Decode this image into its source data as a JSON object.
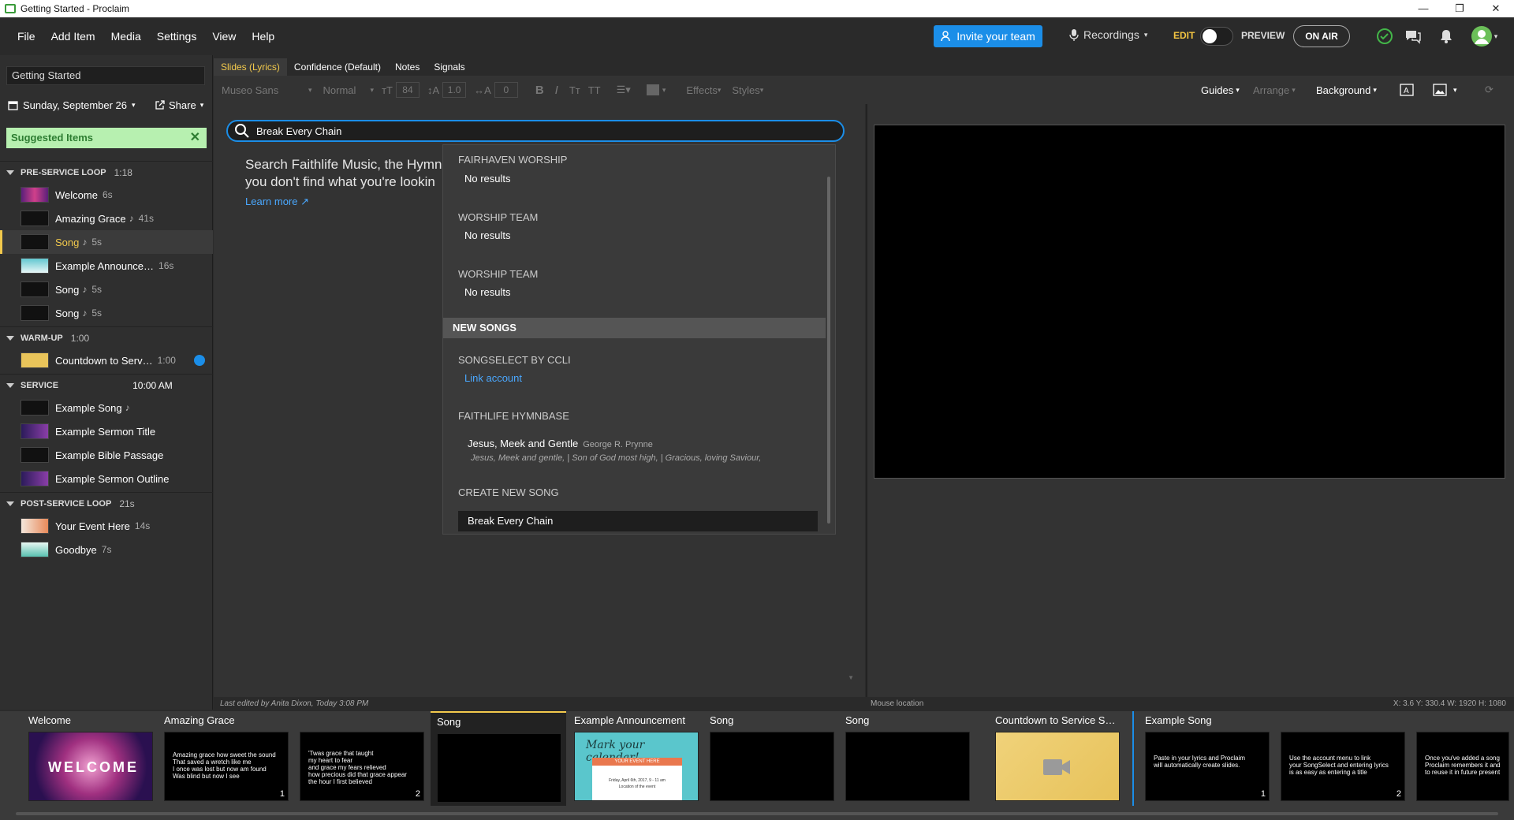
{
  "window": {
    "title": "Getting Started - Proclaim",
    "min": "—",
    "max": "❐",
    "close": "✕"
  },
  "menu": [
    "File",
    "Add Item",
    "Media",
    "Settings",
    "View",
    "Help"
  ],
  "topbar": {
    "invite_label": "Invite your team",
    "recordings_label": "Recordings",
    "edit_label": "EDIT",
    "preview_label": "PREVIEW",
    "onair_label": "ON AIR",
    "accent": "#1b8ee8"
  },
  "left": {
    "doc_name": "Getting Started",
    "date": "Sunday, September 26",
    "share": "Share",
    "suggested": "Suggested Items",
    "sections": [
      {
        "name": "PRE-SERVICE LOOP",
        "dur": "1:18"
      },
      {
        "name": "WARM-UP",
        "dur": "1:00"
      },
      {
        "name": "SERVICE",
        "dur": "10:00 AM"
      },
      {
        "name": "POST-SERVICE LOOP",
        "dur": "21s"
      }
    ],
    "items": [
      {
        "label": "Welcome",
        "dur": "6s"
      },
      {
        "label": "Amazing Grace",
        "note": "♪",
        "dur": "41s"
      },
      {
        "label": "Song",
        "note": "♪",
        "dur": "5s"
      },
      {
        "label": "Example Announce…",
        "dur": "16s"
      },
      {
        "label": "Song",
        "note": "♪",
        "dur": "5s"
      },
      {
        "label": "Song",
        "note": "♪",
        "dur": "5s"
      },
      {
        "label": "Countdown to Serv…",
        "dur": "1:00"
      },
      {
        "label": "Example Song",
        "note": "♪"
      },
      {
        "label": "Example Sermon Title"
      },
      {
        "label": "Example Bible Passage"
      },
      {
        "label": "Example Sermon Outline"
      },
      {
        "label": "Your Event Here",
        "dur": "14s"
      },
      {
        "label": "Goodbye",
        "dur": "7s"
      }
    ]
  },
  "tabs": [
    "Slides (Lyrics)",
    "Confidence (Default)",
    "Notes",
    "Signals"
  ],
  "toolbar": {
    "font": "Museo Sans",
    "style": "Normal",
    "size": "84",
    "line": "1.0",
    "spacing": "0",
    "effects": "Effects",
    "styles": "Styles",
    "guides": "Guides",
    "arrange": "Arrange",
    "background": "Background"
  },
  "search": {
    "value": "Break Every Chain",
    "help_line1": "Search Faithlife Music, the Hymnb",
    "help_line2": "you don't find what you're lookin",
    "learn_more": "Learn more"
  },
  "dropdown": {
    "fairhaven": "FAIRHAVEN WORSHIP",
    "team1": "WORSHIP TEAM",
    "team2": "WORSHIP TEAM",
    "no_results": "No results",
    "new_songs": "NEW SONGS",
    "ccli": "SONGSELECT BY CCLI",
    "link_account": "Link account",
    "hymnbase": "FAITHLIFE HYMNBASE",
    "song_title": "Jesus, Meek and Gentle",
    "song_author": "George R. Prynne",
    "song_lyrics": "Jesus, Meek and gentle, | Son of God most high, | Gracious, loving Saviour,",
    "create": "CREATE NEW SONG",
    "create_value": "Break Every Chain"
  },
  "status": {
    "edited": "Last edited by Anita Dixon, Today 3:08 PM",
    "mouse": "Mouse location",
    "coords": "X: 3.6  Y: 330.4  W: 1920  H: 1080"
  },
  "film": {
    "groups": [
      "Welcome",
      "Amazing Grace",
      "Song",
      "Example Announcement",
      "Song",
      "Song",
      "Countdown to Service S…",
      "Example Song"
    ],
    "welcome_text": "WELCOME",
    "ag1": "Amazing grace how sweet the sound\nThat saved a wretch like me\nI once was lost but now am found\nWas blind but now I see",
    "ag2": "'Twas grace that taught\nmy heart to fear\nand grace my fears relieved\nhow precious did that grace appear\nthe hour I first believed",
    "announce_title": "Mark your calendar!",
    "announce_event": "YOUR EVENT HERE",
    "announce_date": "Friday, April 6th, 2017, 9 - 11 am",
    "announce_loc": "Location of the event",
    "es1": "Paste in your lyrics and Proclaim\nwill automatically create slides.",
    "es2": "Use the account menu to link\nyour SongSelect and entering lyrics\nis as easy as entering a title",
    "es3": "Once you've added a song\nProclaim remembers it and\nto reuse it in future present",
    "n1": "1",
    "n2": "2"
  }
}
